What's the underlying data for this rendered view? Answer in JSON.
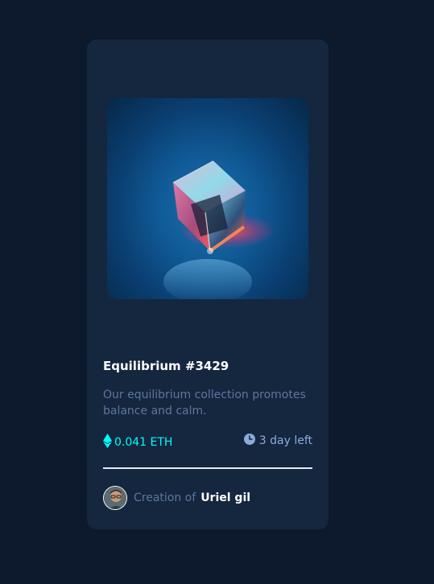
{
  "card": {
    "title": "Equilibrium #3429",
    "description": "Our equilibrium collection promotes balance and calm.",
    "price": "0.041 ETH",
    "time_left": "3 day left",
    "creator_label": "Creation of",
    "creator_name": "Uriel gil"
  },
  "icons": {
    "price": "ethereum-icon",
    "time": "clock-icon"
  },
  "colors": {
    "background": "#0d192c",
    "card": "#15263f",
    "accent_cyan": "#00fff8",
    "soft_blue": "#8bacd9",
    "white": "#ffffff"
  }
}
